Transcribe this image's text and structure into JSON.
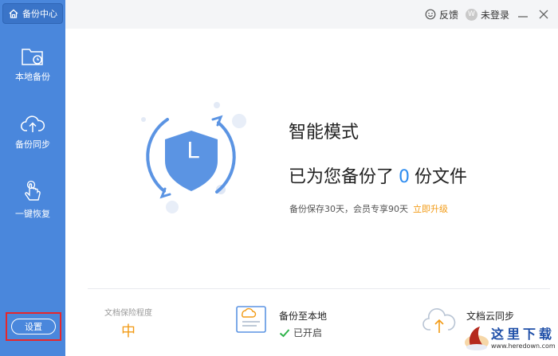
{
  "sidebar": {
    "brand": "备份中心",
    "items": [
      {
        "label": "本地备份",
        "icon": "folder-clock-icon"
      },
      {
        "label": "备份同步",
        "icon": "cloud-upload-icon"
      },
      {
        "label": "一键恢复",
        "icon": "hand-tap-icon"
      }
    ],
    "settings_label": "设置"
  },
  "topbar": {
    "feedback_label": "反馈",
    "user_label": "未登录",
    "avatar_letter": "W"
  },
  "hero": {
    "shield_letter": "L",
    "mode_title": "智能模式",
    "backup_prefix": "已为您备份了",
    "backup_count": "0",
    "backup_suffix": "份文件",
    "retention_text": "备份保存30天，会员专享90天",
    "upgrade_link": "立即升级"
  },
  "status": {
    "protect_label": "文档保险程度",
    "protect_level": "中",
    "local_title": "备份至本地",
    "local_status": "已开启",
    "cloud_title": "文档云同步"
  },
  "watermark": {
    "text": "这里下载",
    "url": "www.heredown.com"
  },
  "colors": {
    "sidebar": "#4a87dc",
    "accent_blue": "#2d8cf0",
    "accent_orange": "#f29b16",
    "highlight_red": "#e8262a"
  }
}
